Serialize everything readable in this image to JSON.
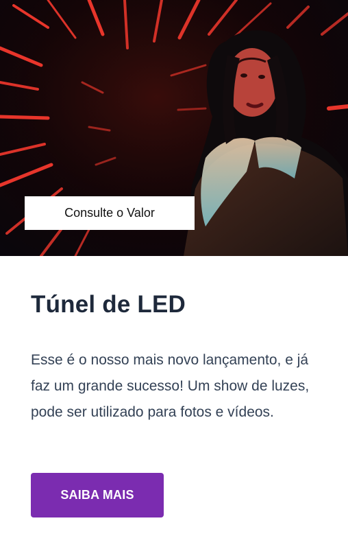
{
  "card": {
    "image_alt": "Mulher em frente a um túnel de luzes LED vermelhas",
    "price_tag": "Consulte o Valor",
    "title": "Túnel de LED",
    "description": "Esse é o nosso mais novo lançamento, e já faz um grande sucesso! Um show de luzes, pode ser utilizado para fotos e vídeos.",
    "button_label": "SAIBA MAIS"
  },
  "colors": {
    "accent": "#7b2cb0",
    "title": "#1e293b",
    "text": "#334155",
    "led": "#ff3b2f"
  }
}
